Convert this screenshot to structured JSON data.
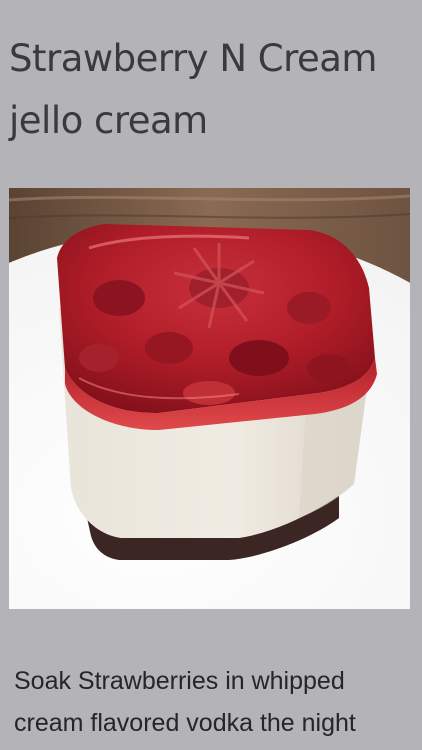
{
  "recipe": {
    "title": "Strawberry N Cream jello cream",
    "image_subject": "strawberry jello cream dessert",
    "description": "Soak Strawberries in whipped cream flavored vodka the night"
  },
  "colors": {
    "background": "#b3b3b8",
    "title_text": "#3a3a3c",
    "body_text": "#262628"
  }
}
